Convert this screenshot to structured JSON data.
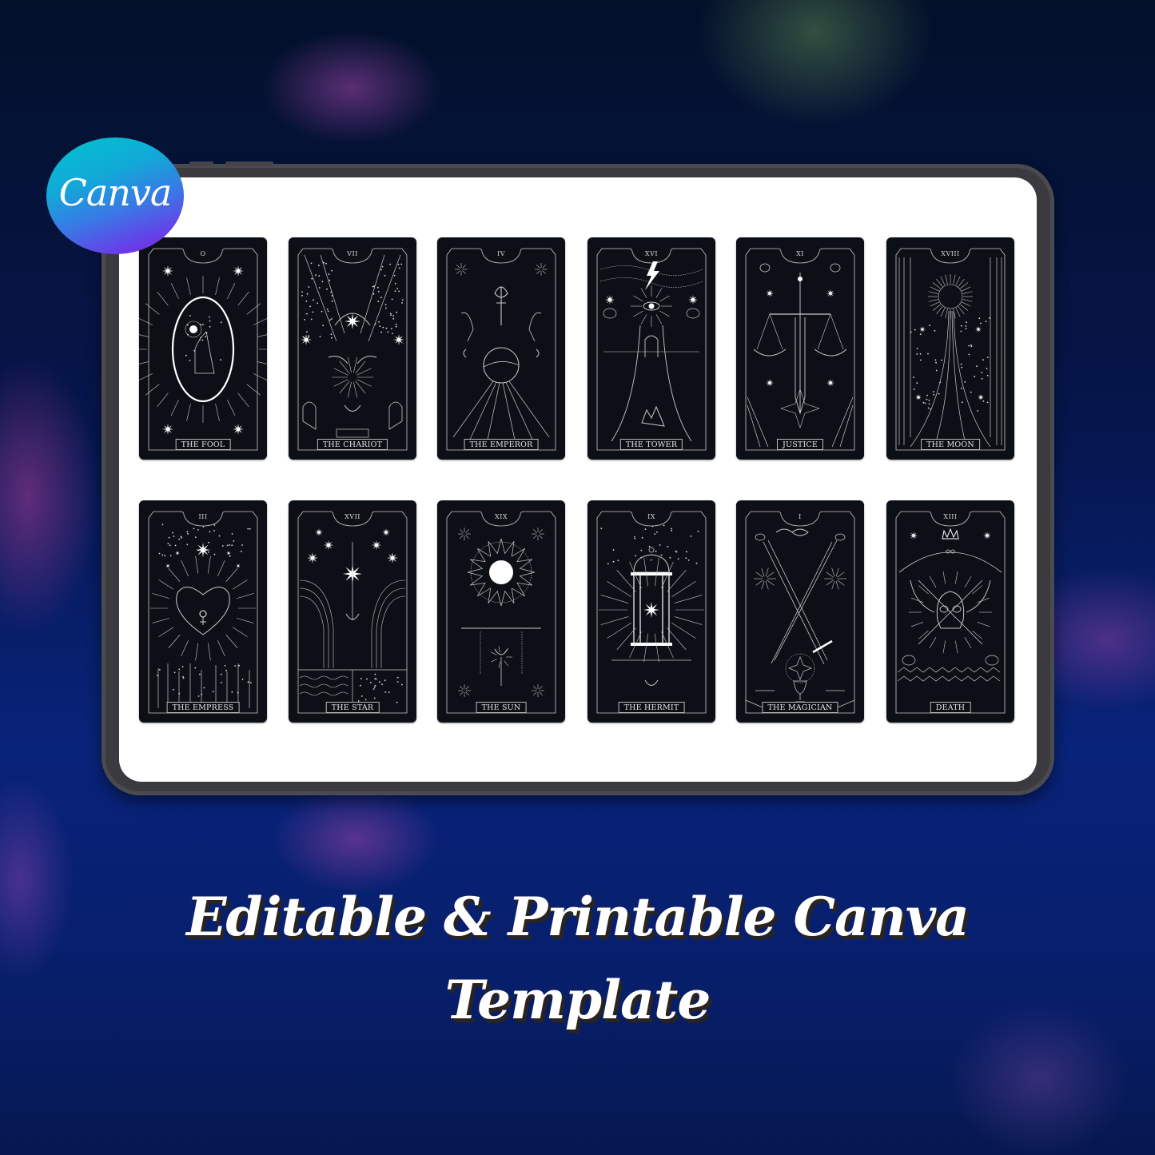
{
  "brand": {
    "logo_text": "Canva",
    "logo_gradient": [
      "#00c4cc",
      "#7b2ff0"
    ]
  },
  "headline": {
    "line1": "Editable & Printable Canva",
    "line2": "Template"
  },
  "colors": {
    "card_background": "#0c1016",
    "screen_background": "#ffffff",
    "tablet_frame": "#3b3b3f",
    "background_deep_blue": "#08237a"
  },
  "cards": [
    {
      "numeral": "O",
      "title": "THE FOOL",
      "motif": "fool"
    },
    {
      "numeral": "VII",
      "title": "THE CHARIOT",
      "motif": "chariot"
    },
    {
      "numeral": "IV",
      "title": "THE EMPEROR",
      "motif": "emperor"
    },
    {
      "numeral": "XVI",
      "title": "THE TOWER",
      "motif": "tower"
    },
    {
      "numeral": "XI",
      "title": "JUSTICE",
      "motif": "justice"
    },
    {
      "numeral": "XVIII",
      "title": "THE MOON",
      "motif": "moon"
    },
    {
      "numeral": "III",
      "title": "THE EMPRESS",
      "motif": "empress"
    },
    {
      "numeral": "XVII",
      "title": "THE STAR",
      "motif": "star"
    },
    {
      "numeral": "XIX",
      "title": "THE SUN",
      "motif": "sun"
    },
    {
      "numeral": "IX",
      "title": "THE HERMIT",
      "motif": "hermit"
    },
    {
      "numeral": "I",
      "title": "THE MAGICIAN",
      "motif": "magician"
    },
    {
      "numeral": "XIII",
      "title": "DEATH",
      "motif": "death"
    }
  ]
}
